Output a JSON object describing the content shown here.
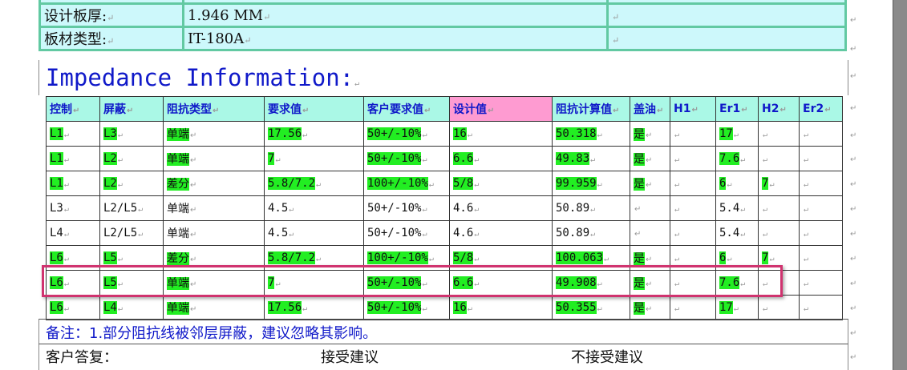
{
  "info_rows": [
    {
      "label": "设计板厚:",
      "value": "1.946 MM"
    },
    {
      "label": "板材类型:",
      "value": "IT-180A"
    }
  ],
  "heading": "Impedance Information:",
  "table": {
    "headers": [
      "控制",
      "屏蔽",
      "阻抗类型",
      "要求值",
      "客户要求值",
      "设计值",
      "阻抗计算值",
      "盖油",
      "H1",
      "Er1",
      "H2",
      "Er2"
    ],
    "rows": [
      [
        "L1",
        "L3",
        "单端",
        "17.56",
        "50+/-10%",
        "16",
        "50.318",
        "是",
        "",
        "17",
        "",
        ""
      ],
      [
        "L1",
        "L2",
        "单端",
        "7",
        "50+/-10%",
        "6.6",
        "49.83",
        "是",
        "",
        "7.6",
        "",
        ""
      ],
      [
        "L1",
        "L2",
        "差分",
        "5.8/7.2",
        "100+/-10%",
        "5/8",
        "99.959",
        "是",
        "",
        "6",
        "7",
        ""
      ],
      [
        "L3",
        "L2/L5",
        "单端",
        "4.5",
        "50+/-10%",
        "4.6",
        "50.89",
        "",
        "",
        "5.4",
        "",
        ""
      ],
      [
        "L4",
        "L2/L5",
        "单端",
        "4.5",
        "50+/-10%",
        "4.6",
        "50.89",
        "",
        "",
        "5.4",
        "",
        ""
      ],
      [
        "L6",
        "L5",
        "差分",
        "5.8/7.2",
        "100+/-10%",
        "5/8",
        "100.063",
        "是",
        "",
        "6",
        "7",
        ""
      ],
      [
        "L6",
        "L5",
        "单端",
        "7",
        "50+/-10%",
        "6.6",
        "49.908",
        "是",
        "",
        "7.6",
        "",
        ""
      ],
      [
        "L6",
        "L4",
        "单端",
        "17.56",
        "50+/-10%",
        "16",
        "50.355",
        "是",
        "",
        "17",
        "",
        ""
      ]
    ],
    "highlighted_rows": [
      0,
      1,
      2,
      5,
      6,
      7
    ],
    "selected_row": 6
  },
  "note": "备注：1.部分阻抗线被邻层屏蔽，建议忽略其影响。",
  "reply": {
    "label": "客户答复：",
    "accept": "接受建议",
    "reject": "不接受建议"
  },
  "colors": {
    "header_bg": "#aaf8e6",
    "header_pink": "#fe9bd1",
    "highlight": "#22ee22",
    "info_bg": "#cdf8fb",
    "heading_text": "#1019c9",
    "selection_border": "#d0336f"
  }
}
